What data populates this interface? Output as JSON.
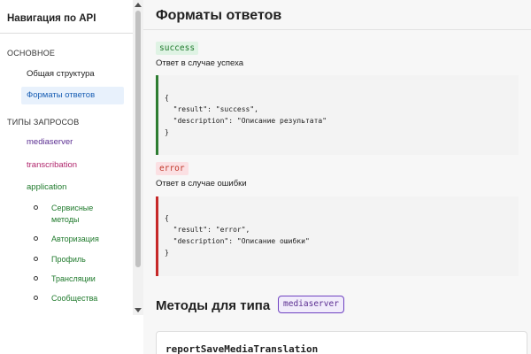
{
  "sidebar": {
    "title": "Навигация по API",
    "sections": [
      {
        "label": "ОСНОВНОЕ",
        "items": [
          {
            "label": "Общая структура",
            "active": false
          },
          {
            "label": "Форматы ответов",
            "active": true
          }
        ]
      },
      {
        "label": "ТИПЫ ЗАПРОСОВ",
        "items": [
          {
            "label": "mediaserver",
            "color": "#5a2d91"
          },
          {
            "label": "transcribation",
            "color": "#b0246b"
          },
          {
            "label": "application",
            "color": "#1f7a2c"
          }
        ],
        "subitems": [
          "Сервисные",
          "методы",
          "Авторизация",
          "Профиль",
          "Трансляции",
          "Сообщества"
        ]
      }
    ]
  },
  "main": {
    "title": "Форматы ответов",
    "success": {
      "tag": "success",
      "caption": "Ответ в случае успеха",
      "code": "{\n  \"result\": \"success\",\n  \"description\": \"Описание результата\"\n}"
    },
    "error": {
      "tag": "error",
      "caption": "Ответ в случае ошибки",
      "code": "{\n  \"result\": \"error\",\n  \"description\": \"Описание ошибки\"\n}"
    },
    "methods_heading": "Методы для типа",
    "methods_type": "mediaserver",
    "first_method": "reportSaveMediaTranslation"
  },
  "colors": {
    "active_bg": "#e8f1fc",
    "success_border": "#2e7d32",
    "error_border": "#c62828",
    "mediaserver": "#5a2d91",
    "transcribation": "#b0246b",
    "application": "#1f7a2c"
  }
}
